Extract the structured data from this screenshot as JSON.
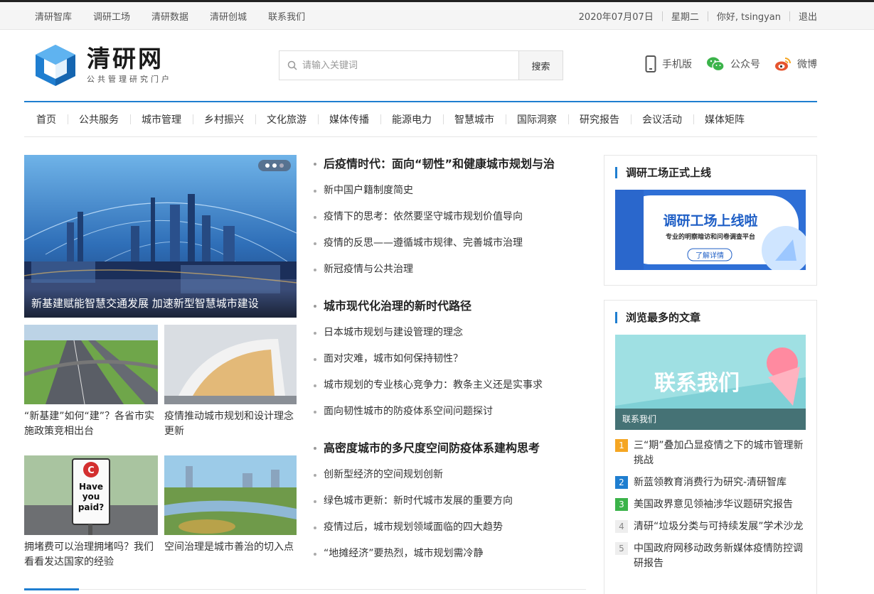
{
  "topbar": {
    "links": [
      "清研智库",
      "调研工场",
      "清研数据",
      "清研创城",
      "联系我们"
    ],
    "date": "2020年07月07日",
    "weekday": "星期二",
    "greeting": "你好, tsingyan",
    "logout": "退出"
  },
  "logo": {
    "name": "清研网",
    "tagline": "公共管理研究门户"
  },
  "search": {
    "placeholder": "请输入关键词",
    "button": "搜索"
  },
  "quick_links": {
    "mobile": "手机版",
    "wechat": "公众号",
    "weibo": "微博"
  },
  "nav": [
    "首页",
    "公共服务",
    "城市管理",
    "乡村振兴",
    "文化旅游",
    "媒体传播",
    "能源电力",
    "智慧城市",
    "国际洞察",
    "研究报告",
    "会议活动",
    "媒体矩阵"
  ],
  "hero": {
    "caption": "新基建赋能智慧交通发展 加速新型智慧城市建设"
  },
  "thumbs": [
    "“新基建”如何“建”？各省市实施政策竞相出台",
    "疫情推动城市规划和设计理念更新",
    "拥堵费可以治理拥堵吗？我们看看发达国家的经验",
    "空间治理是城市善治的切入点"
  ],
  "thumb_sign": [
    "Have",
    "you",
    "paid?"
  ],
  "news_groups": [
    {
      "headline": "后疫情时代：面向“韧性”和健康城市规划与治",
      "items": [
        "新中国户籍制度简史",
        "疫情下的思考：依然要坚守城市规划价值导向",
        "疫情的反思——遵循城市规律、完善城市治理",
        "新冠疫情与公共治理"
      ]
    },
    {
      "headline": "城市现代化治理的新时代路径",
      "items": [
        "日本城市规划与建设管理的理念",
        "面对灾难，城市如何保持韧性？",
        "城市规划的专业核心竞争力：教条主义还是实事求",
        "面向韧性城市的防疫体系空间问题探讨"
      ]
    },
    {
      "headline": "高密度城市的多尺度空间防疫体系建构思考",
      "items": [
        "创新型经济的空间规划创新",
        "绿色城市更新：新时代城市发展的重要方向",
        "疫情过后，城市规划领域面临的四大趋势",
        "“地摊经济”要热烈，城市规划需冷静"
      ]
    }
  ],
  "sidebar": {
    "panel1": {
      "title": "调研工场正式上线",
      "ad_title": "调研工场上线啦",
      "ad_sub": "专业的明察暗访和问卷调查平台",
      "ad_btn": "了解详情"
    },
    "panel2": {
      "title": "浏览最多的文章",
      "banner_text": "联系我们",
      "banner_caption": "联系我们",
      "ranking": [
        {
          "num": "1",
          "title": "三“期”叠加凸显疫情之下的城市管理新挑战"
        },
        {
          "num": "2",
          "title": "新蓝领教育消费行为研究-清研智库"
        },
        {
          "num": "3",
          "title": "美国政界意见领袖涉华议题研究报告"
        },
        {
          "num": "4",
          "title": "清研“垃圾分类与可持续发展”学术沙龙"
        },
        {
          "num": "5",
          "title": "中国政府网移动政务新媒体疫情防控调研报告"
        }
      ]
    }
  },
  "colors": {
    "accent": "#1f7ed0",
    "rank1": "#f5a623",
    "rank2": "#1f7ed0",
    "rank3": "#3bb34a"
  }
}
